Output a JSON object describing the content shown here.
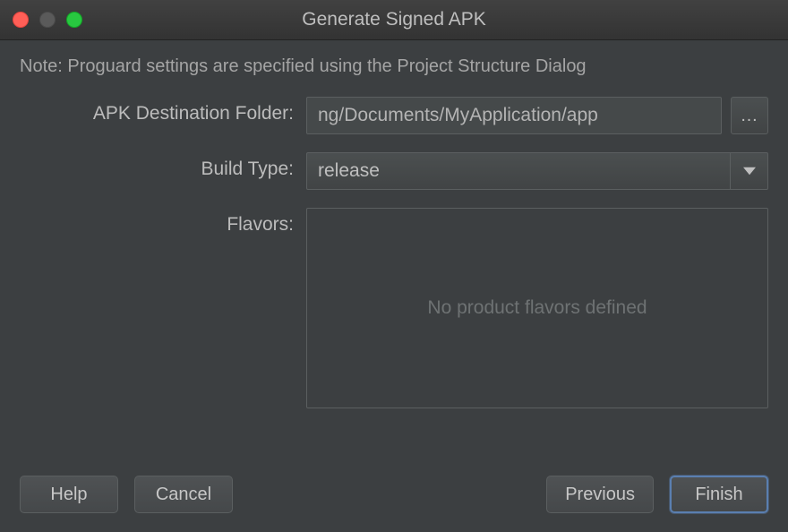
{
  "titlebar": {
    "title": "Generate Signed APK"
  },
  "note": "Note: Proguard settings are specified using the Project Structure Dialog",
  "labels": {
    "apk_destination": "APK Destination Folder:",
    "build_type": "Build Type:",
    "flavors": "Flavors:"
  },
  "fields": {
    "apk_destination_value": "ng/Documents/MyApplication/app",
    "build_type_selected": "release",
    "browse_symbol": "…",
    "flavors_placeholder": "No product flavors defined"
  },
  "buttons": {
    "help": "Help",
    "cancel": "Cancel",
    "previous": "Previous",
    "finish": "Finish"
  }
}
